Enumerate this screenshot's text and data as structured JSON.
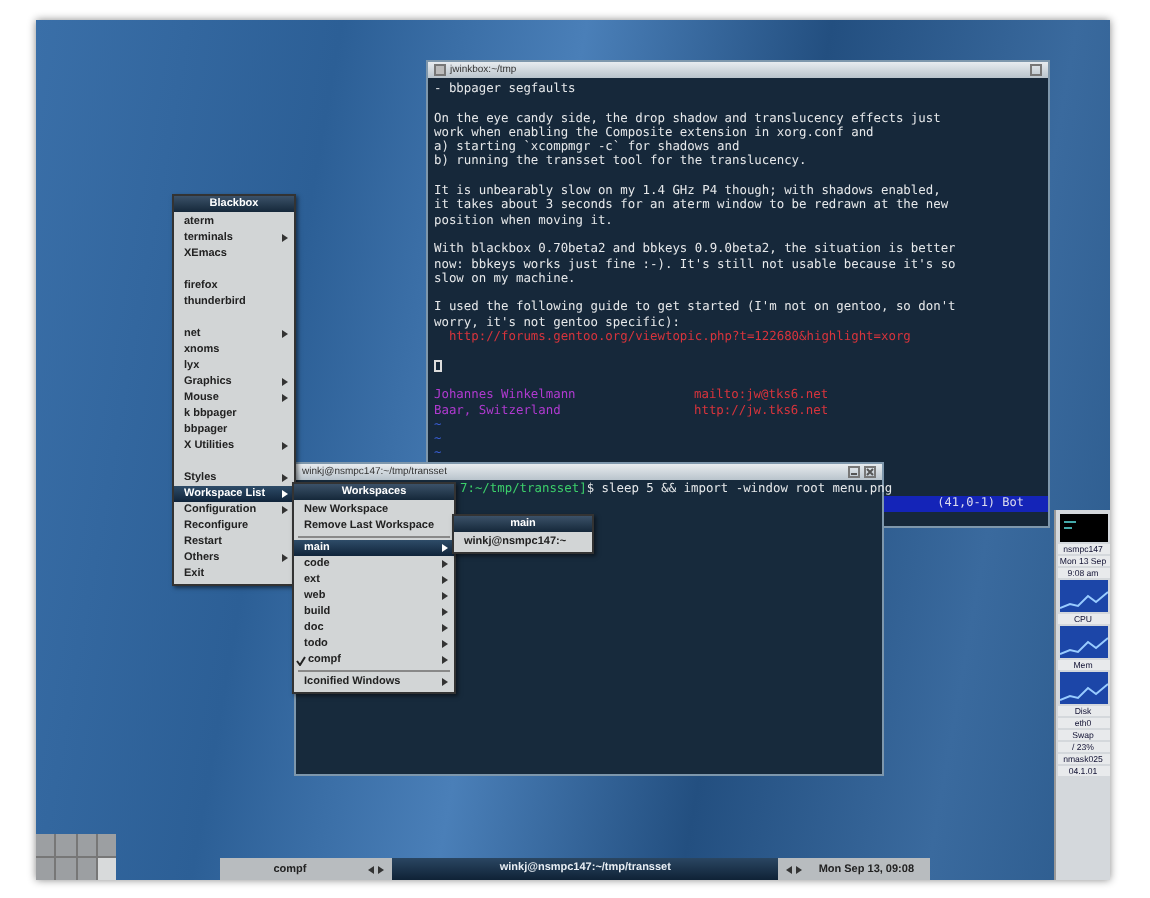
{
  "editor_window": {
    "title": "jwinkbox:~/tmp",
    "status": "(41,0-1)  Bot",
    "lines": [
      {
        "kind": "text",
        "text": "- bbpager segfaults"
      },
      {
        "kind": "blank"
      },
      {
        "kind": "text",
        "text": "On the eye candy side, the drop shadow and translucency effects just"
      },
      {
        "kind": "text",
        "text": "work when enabling the Composite extension in xorg.conf and"
      },
      {
        "kind": "text",
        "text": "a) starting `xcompmgr -c` for shadows and"
      },
      {
        "kind": "text",
        "text": "b) running the transset tool for the translucency."
      },
      {
        "kind": "blank"
      },
      {
        "kind": "text",
        "text": "It is unbearably slow on my 1.4 GHz P4 though; with shadows enabled,"
      },
      {
        "kind": "text",
        "text": "it takes about 3 seconds for an aterm window to be redrawn at the new"
      },
      {
        "kind": "text",
        "text": "position when moving it."
      },
      {
        "kind": "blank"
      },
      {
        "kind": "text",
        "text": "With blackbox 0.70beta2 and bbkeys 0.9.0beta2, the situation is better"
      },
      {
        "kind": "text",
        "text": "now: bbkeys works just fine :-). It's still not usable because it's so"
      },
      {
        "kind": "text",
        "text": "slow on my machine."
      },
      {
        "kind": "blank"
      },
      {
        "kind": "text",
        "text": "I used the following guide to get started (I'm not on gentoo, so don't"
      },
      {
        "kind": "text",
        "text": "worry, it's not gentoo specific):"
      },
      {
        "kind": "link",
        "text": "  http://forums.gentoo.org/viewtopic.php?t=122680&highlight=xorg"
      },
      {
        "kind": "blank"
      },
      {
        "kind": "cursor"
      },
      {
        "kind": "blank"
      },
      {
        "kind": "pair",
        "left": "Johannes Winkelmann",
        "right": "mailto:jw@tks6.net"
      },
      {
        "kind": "pair",
        "left": "Baar, Switzerland",
        "right": "http://jw.tks6.net"
      },
      {
        "kind": "tilde",
        "text": "~"
      },
      {
        "kind": "tilde",
        "text": "~"
      },
      {
        "kind": "tilde",
        "text": "~"
      }
    ]
  },
  "terminal_window": {
    "title": "winkj@nsmpc147:~/tmp/transset",
    "prompt": "7:~/tmp/transset]",
    "command": "$ sleep 5 && import -window root menu.png"
  },
  "root_menu": {
    "title": "Blackbox",
    "items": [
      {
        "kind": "item",
        "label": "aterm",
        "submenu": false,
        "selected": false
      },
      {
        "kind": "item",
        "label": "terminals",
        "submenu": true,
        "selected": false
      },
      {
        "kind": "item",
        "label": "XEmacs",
        "submenu": false,
        "selected": false
      },
      {
        "kind": "gap"
      },
      {
        "kind": "item",
        "label": "firefox",
        "submenu": false,
        "selected": false
      },
      {
        "kind": "item",
        "label": "thunderbird",
        "submenu": false,
        "selected": false
      },
      {
        "kind": "gap"
      },
      {
        "kind": "item",
        "label": "net",
        "submenu": true,
        "selected": false
      },
      {
        "kind": "item",
        "label": "xnoms",
        "submenu": false,
        "selected": false
      },
      {
        "kind": "item",
        "label": "lyx",
        "submenu": false,
        "selected": false
      },
      {
        "kind": "item",
        "label": "Graphics",
        "submenu": true,
        "selected": false
      },
      {
        "kind": "item",
        "label": "Mouse",
        "submenu": true,
        "selected": false
      },
      {
        "kind": "item",
        "label": "k bbpager",
        "submenu": false,
        "selected": false
      },
      {
        "kind": "item",
        "label": "bbpager",
        "submenu": false,
        "selected": false
      },
      {
        "kind": "item",
        "label": "X Utilities",
        "submenu": true,
        "selected": false
      },
      {
        "kind": "gap"
      },
      {
        "kind": "item",
        "label": "Styles",
        "submenu": true,
        "selected": false
      },
      {
        "kind": "item",
        "label": "Workspace List",
        "submenu": true,
        "selected": true
      },
      {
        "kind": "item",
        "label": "Configuration",
        "submenu": true,
        "selected": false
      },
      {
        "kind": "item",
        "label": "Reconfigure",
        "submenu": false,
        "selected": false
      },
      {
        "kind": "item",
        "label": "Restart",
        "submenu": false,
        "selected": false
      },
      {
        "kind": "item",
        "label": "Others",
        "submenu": true,
        "selected": false
      },
      {
        "kind": "item",
        "label": "Exit",
        "submenu": false,
        "selected": false
      }
    ]
  },
  "workspaces_menu": {
    "title": "Workspaces",
    "items": [
      {
        "kind": "item",
        "label": "New Workspace",
        "submenu": false,
        "selected": false,
        "checked": false
      },
      {
        "kind": "item",
        "label": "Remove Last Workspace",
        "submenu": false,
        "selected": false,
        "checked": false
      },
      {
        "kind": "separator"
      },
      {
        "kind": "item",
        "label": "main",
        "submenu": true,
        "selected": true,
        "checked": false
      },
      {
        "kind": "item",
        "label": "code",
        "submenu": true,
        "selected": false,
        "checked": false
      },
      {
        "kind": "item",
        "label": "ext",
        "submenu": true,
        "selected": false,
        "checked": false
      },
      {
        "kind": "item",
        "label": "web",
        "submenu": true,
        "selected": false,
        "checked": false
      },
      {
        "kind": "item",
        "label": "build",
        "submenu": true,
        "selected": false,
        "checked": false
      },
      {
        "kind": "item",
        "label": "doc",
        "submenu": true,
        "selected": false,
        "checked": false
      },
      {
        "kind": "item",
        "label": "todo",
        "submenu": true,
        "selected": false,
        "checked": false
      },
      {
        "kind": "item",
        "label": "compf",
        "submenu": true,
        "selected": false,
        "checked": true
      },
      {
        "kind": "separator"
      },
      {
        "kind": "item",
        "label": "Iconified Windows",
        "submenu": true,
        "selected": false,
        "checked": false
      }
    ]
  },
  "main_menu": {
    "title": "main",
    "items": [
      {
        "kind": "item",
        "label": "winkj@nsmpc147:~",
        "submenu": false,
        "selected": false
      }
    ]
  },
  "taskbar": {
    "workspace": "compf",
    "window": "winkj@nsmpc147:~/tmp/transset",
    "clock": "Mon Sep 13, 09:08"
  },
  "pager": {
    "cells": [
      {
        "selected": false
      },
      {
        "selected": false
      },
      {
        "selected": false
      },
      {
        "selected": false
      },
      {
        "selected": false
      },
      {
        "selected": false
      },
      {
        "selected": false
      },
      {
        "selected": true
      }
    ]
  },
  "dock": {
    "labels": [
      "nsmpc147",
      "Mon 13 Sep",
      "9:08 am"
    ],
    "graph_labels": [
      "CPU",
      "Mem",
      "Disk"
    ],
    "bottom_labels": [
      "eth0",
      "Swap",
      "/ 23%",
      "nmask025",
      "04.1.01"
    ]
  }
}
